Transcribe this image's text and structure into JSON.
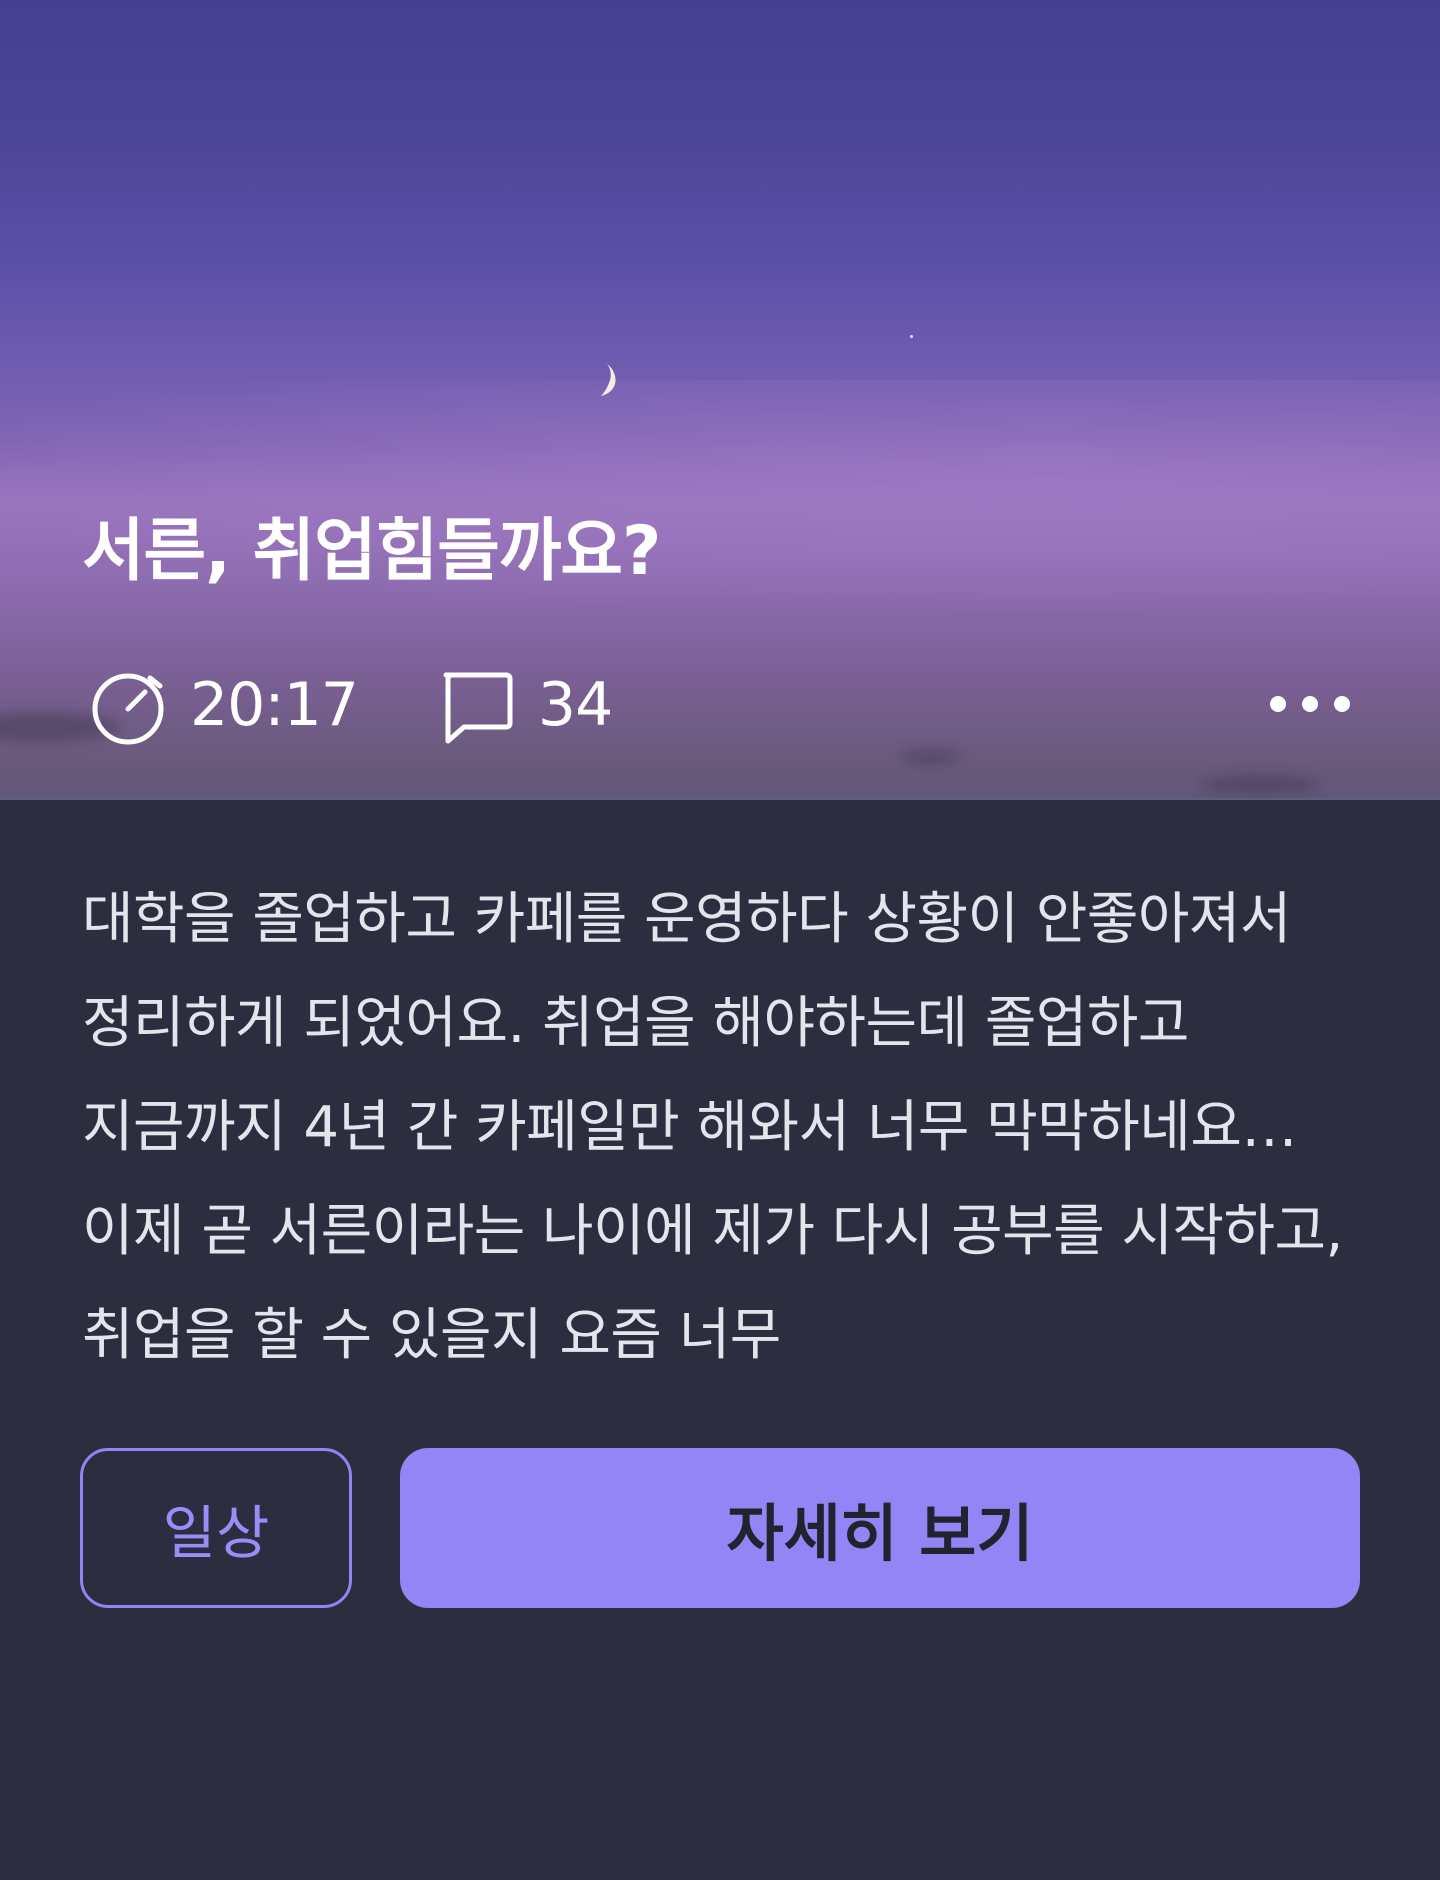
{
  "post": {
    "title": "서른, 취업힘들까요?",
    "time": "20:17",
    "comment_count": "34",
    "excerpt": "대학을 졸업하고 카페를 운영하다 상황이 안좋아져서 정리하게 되었어요. 취업을 해야하는데 졸업하고 지금까지 4년 간 카페일만 해와서 너무 막막하네요… 이제 곧 서른이라는 나이에 제가 다시 공부를 시작하고, 취업을 할 수 있을지 요즘 너무"
  },
  "icons": {
    "time": "stopwatch-icon",
    "comments": "speech-bubble-icon",
    "more": "more-dots-icon",
    "moon": "crescent-moon"
  },
  "actions": {
    "tag_label": "일상",
    "detail_label": "자세히 보기"
  },
  "colors": {
    "accent": "#9485f6",
    "body_bg": "#2d2d40",
    "title_text": "#ffffff",
    "body_text": "#e4e4ec"
  }
}
